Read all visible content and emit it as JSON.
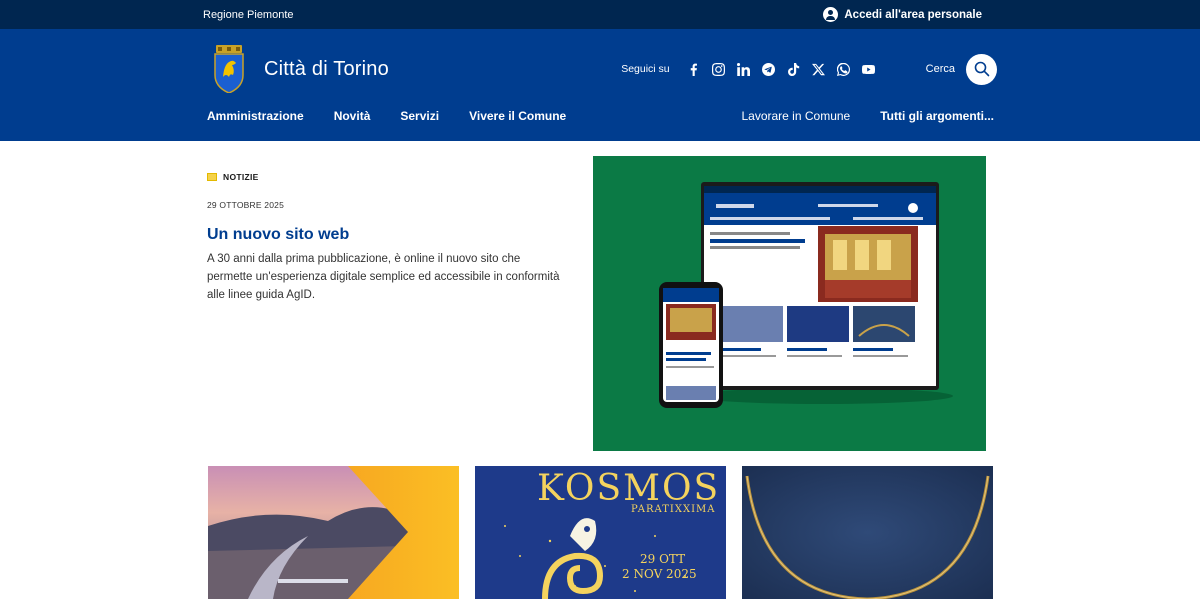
{
  "slim": {
    "region": "Regione Piemonte",
    "login_label": "Accedi all'area personale"
  },
  "brand": {
    "name": "Città di Torino"
  },
  "social": {
    "follow_label": "Seguici su",
    "icons": [
      "facebook-icon",
      "instagram-icon",
      "linkedin-icon",
      "telegram-icon",
      "tiktok-icon",
      "x-icon",
      "whatsapp-icon",
      "youtube-icon"
    ]
  },
  "search": {
    "label": "Cerca"
  },
  "nav": {
    "main": [
      "Amministrazione",
      "Novità",
      "Servizi",
      "Vivere il Comune"
    ],
    "right": [
      "Lavorare in Comune",
      "Tutti gli argomenti..."
    ]
  },
  "hero": {
    "category": "NOTIZIE",
    "date": "29 OTTOBRE 2025",
    "title": "Un nuovo sito web",
    "description": "A 30 anni dalla prima pubblicazione, è online il nuovo sito che permette un'esperienza digitale semplice ed accessibile in conformità alle linee guida AgID."
  },
  "cards": {
    "kosmos_title": "KOSMOS",
    "kosmos_sub": "PARATIXXIMA",
    "kosmos_date1": "29 OTT",
    "kosmos_date2": "2 NOV 2025"
  },
  "colors": {
    "slim_bg": "#002650",
    "header_bg": "#003d8f",
    "accent_title": "#003d8f",
    "hero_image_bg": "#0b7a45"
  }
}
